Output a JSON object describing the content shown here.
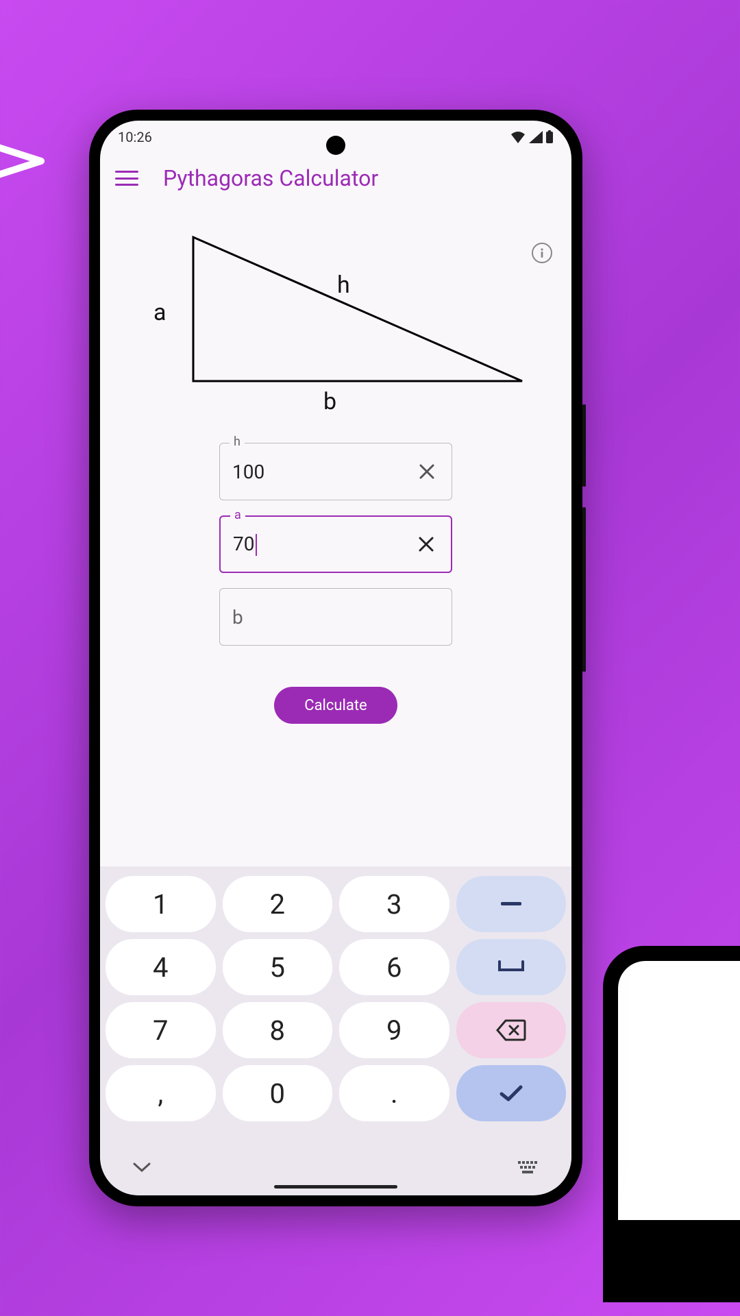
{
  "statusbar": {
    "time": "10:26"
  },
  "appbar": {
    "title": "Pythagoras Calculator"
  },
  "triangle": {
    "label_a": "a",
    "label_b": "b",
    "label_h": "h"
  },
  "fields": {
    "h": {
      "label": "h",
      "value": "100"
    },
    "a": {
      "label": "a",
      "value": "70"
    },
    "b": {
      "label": "b",
      "value": ""
    }
  },
  "calc_button": "Calculate",
  "keyboard": {
    "rows": [
      [
        "1",
        "2",
        "3",
        "-"
      ],
      [
        "4",
        "5",
        "6",
        "␣"
      ],
      [
        "7",
        "8",
        "9",
        "⌫"
      ],
      [
        ",",
        "0",
        ".",
        "✓"
      ]
    ]
  }
}
